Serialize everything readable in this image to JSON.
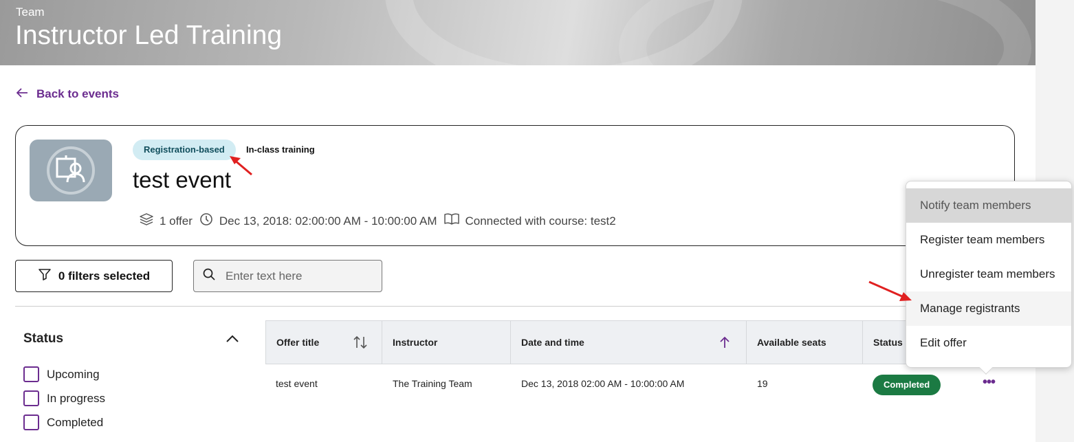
{
  "banner": {
    "eyebrow": "Team",
    "title": "Instructor Led Training"
  },
  "back_link": {
    "label": "Back to events",
    "icon": "arrow-left-icon"
  },
  "event": {
    "badge": "Registration-based",
    "type": "In-class training",
    "title": "test event",
    "offers": "1 offer",
    "datetime": "Dec 13, 2018: 02:00:00 AM - 10:00:00 AM",
    "course": "Connected with course: test2"
  },
  "filters": {
    "button_label": "0 filters selected",
    "search_placeholder": "Enter text here"
  },
  "status_filter": {
    "title": "Status",
    "options": [
      "Upcoming",
      "In progress",
      "Completed"
    ]
  },
  "table": {
    "columns": [
      "Offer title",
      "Instructor",
      "Date and time",
      "Available seats",
      "Status"
    ],
    "rows": [
      {
        "title": "test event",
        "instructor": "The Training Team",
        "datetime": "Dec 13, 2018 02:00 AM - 10:00:00 AM",
        "seats": "19",
        "status": "Completed"
      }
    ]
  },
  "context_menu": {
    "items": [
      "Notify team members",
      "Register team members",
      "Unregister team members",
      "Manage registrants",
      "Edit offer"
    ]
  },
  "colors": {
    "accent": "#6b2c8f",
    "completed": "#1b7a43",
    "badge_bg": "#d2ecf3",
    "annotation": "#e02020"
  }
}
